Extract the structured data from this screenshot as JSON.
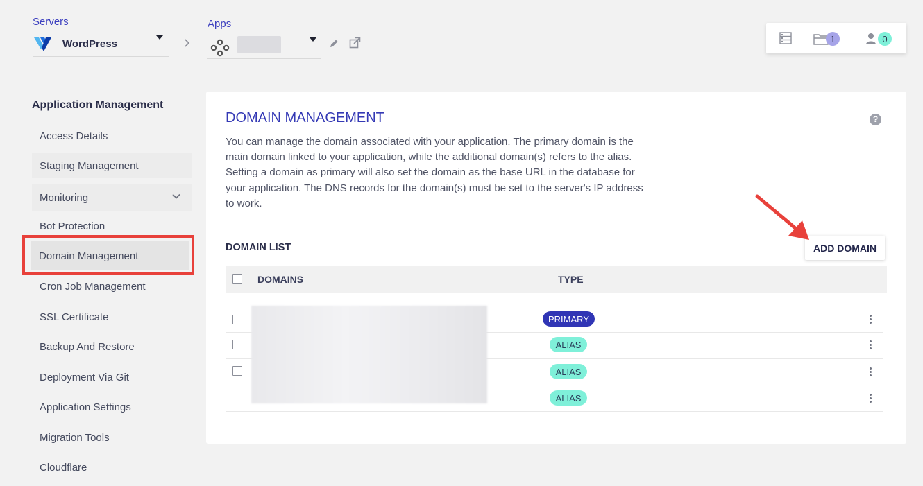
{
  "breadcrumb": {
    "servers_label": "Servers",
    "server_name": "WordPress",
    "apps_label": "Apps"
  },
  "top_actions": {
    "folder_count": "1",
    "users_count": "0",
    "colors": {
      "folder_badge": "#a6a4e8",
      "users_badge": "#7ff0d9"
    }
  },
  "sidebar": {
    "title": "Application Management",
    "items": [
      {
        "label": "Access Details"
      },
      {
        "label": "Staging Management"
      },
      {
        "label": "Monitoring"
      },
      {
        "label": "Bot Protection"
      },
      {
        "label": "Domain Management"
      },
      {
        "label": "Cron Job Management"
      },
      {
        "label": "SSL Certificate"
      },
      {
        "label": "Backup And Restore"
      },
      {
        "label": "Deployment Via Git"
      },
      {
        "label": "Application Settings"
      },
      {
        "label": "Migration Tools"
      },
      {
        "label": "Cloudflare"
      }
    ]
  },
  "main": {
    "title": "DOMAIN MANAGEMENT",
    "help_icon": "?",
    "description": "You can manage the domain associated with your application. The primary domain is the main domain linked to your application, while the additional domain(s) refers to the alias. Setting a domain as primary will also set the domain as the base URL in the database for your application. The DNS records for the domain(s) must be set to the server's IP address to work.",
    "list_title": "DOMAIN LIST",
    "add_button": "ADD DOMAIN",
    "table": {
      "headers": {
        "domains": "DOMAINS",
        "type": "TYPE"
      },
      "rows": [
        {
          "type": "PRIMARY"
        },
        {
          "type": "ALIAS"
        },
        {
          "type": "ALIAS"
        },
        {
          "type": "ALIAS"
        }
      ]
    }
  },
  "colors": {
    "accent": "#3439b5",
    "highlight": "#e8413b",
    "alias_tag": "#7ff0d9",
    "primary_tag": "#3035b5"
  }
}
